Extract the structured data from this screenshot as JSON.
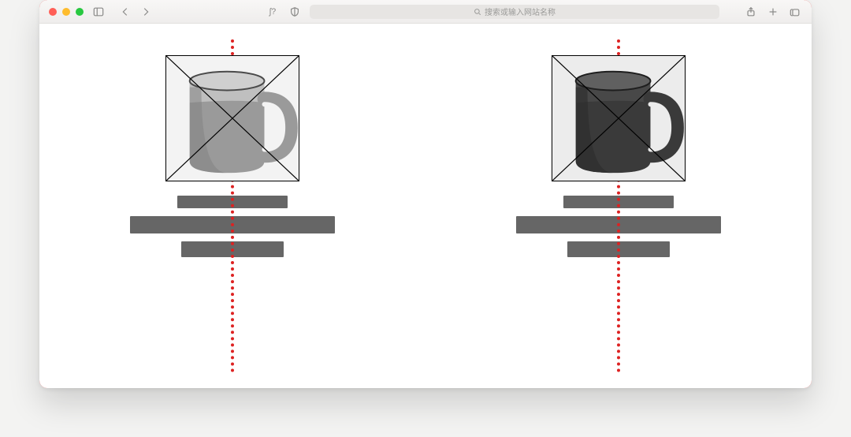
{
  "browser": {
    "address_placeholder": "搜索或输入网站名称",
    "reader_glyph": "ʃ?"
  },
  "products": [
    {
      "name": "mug-light",
      "body_fill": "#9a9a9a",
      "body_shade": "#7f7f7f",
      "inner_fill": "#cfcfcf",
      "rim_stroke": "#4a4a4a",
      "highlight": "#d8d8d8"
    },
    {
      "name": "mug-dark",
      "body_fill": "#3a3a3a",
      "body_shade": "#2c2c2c",
      "inner_fill": "#606060",
      "rim_stroke": "#1e1e1e",
      "highlight": "#565656"
    }
  ]
}
